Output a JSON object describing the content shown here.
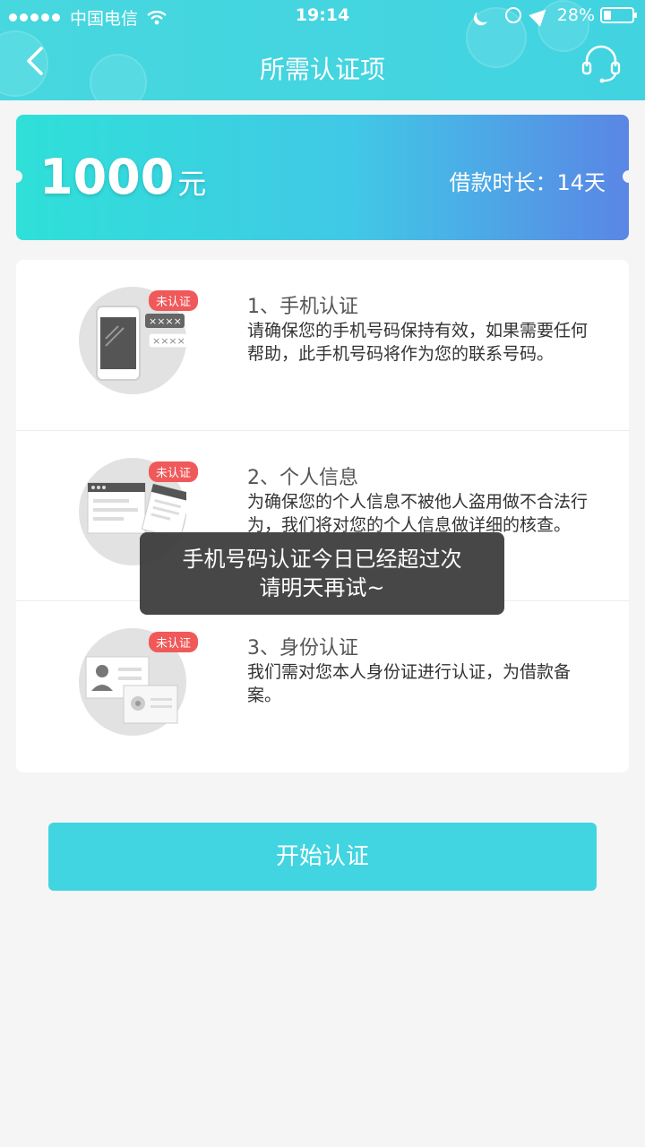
{
  "status_bar": {
    "carrier": "中国电信",
    "time": "19:14",
    "battery": "28%"
  },
  "nav": {
    "title": "所需认证项"
  },
  "amount_card": {
    "amount": "1000",
    "unit": "元",
    "loan_term": "借款时长：14天"
  },
  "items": [
    {
      "badge": "未认证",
      "title": "1、手机认证",
      "desc": "请确保您的手机号码保持有效，如果需要任何帮助，此手机号码将作为您的联系号码。",
      "icon": "phone-icon"
    },
    {
      "badge": "未认证",
      "title": "2、个人信息",
      "desc": "为确保您的个人信息不被他人盗用做不合法行为，我们将对您的个人信息做详细的核查。",
      "icon": "document-icon"
    },
    {
      "badge": "未认证",
      "title": "3、身份认证",
      "desc": "我们需对您本人身份证进行认证，为借款备案。",
      "icon": "id-card-icon"
    }
  ],
  "toast": {
    "line1": "手机号码认证今日已经超过次",
    "line2": "请明天再试~"
  },
  "start_button": {
    "label": "开始认证"
  },
  "colors": {
    "header": "#41d3e0",
    "badge": "#f0595a",
    "button": "#40d5e0"
  }
}
